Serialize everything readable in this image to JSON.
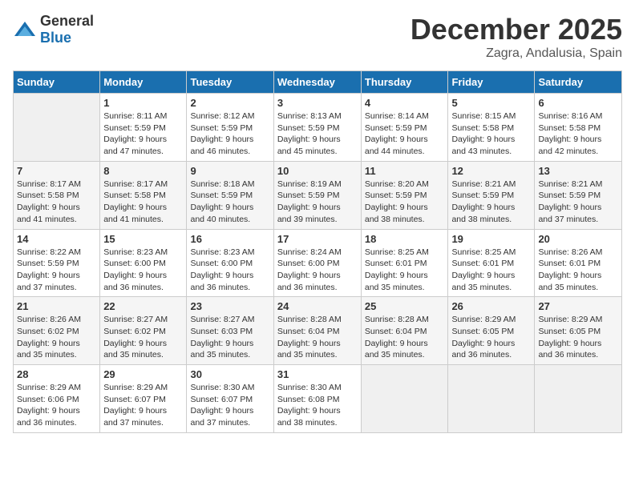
{
  "header": {
    "logo_general": "General",
    "logo_blue": "Blue",
    "month": "December 2025",
    "location": "Zagra, Andalusia, Spain"
  },
  "calendar": {
    "days_of_week": [
      "Sunday",
      "Monday",
      "Tuesday",
      "Wednesday",
      "Thursday",
      "Friday",
      "Saturday"
    ],
    "weeks": [
      [
        {
          "day": "",
          "info": ""
        },
        {
          "day": "1",
          "info": "Sunrise: 8:11 AM\nSunset: 5:59 PM\nDaylight: 9 hours\nand 47 minutes."
        },
        {
          "day": "2",
          "info": "Sunrise: 8:12 AM\nSunset: 5:59 PM\nDaylight: 9 hours\nand 46 minutes."
        },
        {
          "day": "3",
          "info": "Sunrise: 8:13 AM\nSunset: 5:59 PM\nDaylight: 9 hours\nand 45 minutes."
        },
        {
          "day": "4",
          "info": "Sunrise: 8:14 AM\nSunset: 5:59 PM\nDaylight: 9 hours\nand 44 minutes."
        },
        {
          "day": "5",
          "info": "Sunrise: 8:15 AM\nSunset: 5:58 PM\nDaylight: 9 hours\nand 43 minutes."
        },
        {
          "day": "6",
          "info": "Sunrise: 8:16 AM\nSunset: 5:58 PM\nDaylight: 9 hours\nand 42 minutes."
        }
      ],
      [
        {
          "day": "7",
          "info": "Sunrise: 8:17 AM\nSunset: 5:58 PM\nDaylight: 9 hours\nand 41 minutes."
        },
        {
          "day": "8",
          "info": "Sunrise: 8:17 AM\nSunset: 5:58 PM\nDaylight: 9 hours\nand 41 minutes."
        },
        {
          "day": "9",
          "info": "Sunrise: 8:18 AM\nSunset: 5:59 PM\nDaylight: 9 hours\nand 40 minutes."
        },
        {
          "day": "10",
          "info": "Sunrise: 8:19 AM\nSunset: 5:59 PM\nDaylight: 9 hours\nand 39 minutes."
        },
        {
          "day": "11",
          "info": "Sunrise: 8:20 AM\nSunset: 5:59 PM\nDaylight: 9 hours\nand 38 minutes."
        },
        {
          "day": "12",
          "info": "Sunrise: 8:21 AM\nSunset: 5:59 PM\nDaylight: 9 hours\nand 38 minutes."
        },
        {
          "day": "13",
          "info": "Sunrise: 8:21 AM\nSunset: 5:59 PM\nDaylight: 9 hours\nand 37 minutes."
        }
      ],
      [
        {
          "day": "14",
          "info": "Sunrise: 8:22 AM\nSunset: 5:59 PM\nDaylight: 9 hours\nand 37 minutes."
        },
        {
          "day": "15",
          "info": "Sunrise: 8:23 AM\nSunset: 6:00 PM\nDaylight: 9 hours\nand 36 minutes."
        },
        {
          "day": "16",
          "info": "Sunrise: 8:23 AM\nSunset: 6:00 PM\nDaylight: 9 hours\nand 36 minutes."
        },
        {
          "day": "17",
          "info": "Sunrise: 8:24 AM\nSunset: 6:00 PM\nDaylight: 9 hours\nand 36 minutes."
        },
        {
          "day": "18",
          "info": "Sunrise: 8:25 AM\nSunset: 6:01 PM\nDaylight: 9 hours\nand 35 minutes."
        },
        {
          "day": "19",
          "info": "Sunrise: 8:25 AM\nSunset: 6:01 PM\nDaylight: 9 hours\nand 35 minutes."
        },
        {
          "day": "20",
          "info": "Sunrise: 8:26 AM\nSunset: 6:01 PM\nDaylight: 9 hours\nand 35 minutes."
        }
      ],
      [
        {
          "day": "21",
          "info": "Sunrise: 8:26 AM\nSunset: 6:02 PM\nDaylight: 9 hours\nand 35 minutes."
        },
        {
          "day": "22",
          "info": "Sunrise: 8:27 AM\nSunset: 6:02 PM\nDaylight: 9 hours\nand 35 minutes."
        },
        {
          "day": "23",
          "info": "Sunrise: 8:27 AM\nSunset: 6:03 PM\nDaylight: 9 hours\nand 35 minutes."
        },
        {
          "day": "24",
          "info": "Sunrise: 8:28 AM\nSunset: 6:04 PM\nDaylight: 9 hours\nand 35 minutes."
        },
        {
          "day": "25",
          "info": "Sunrise: 8:28 AM\nSunset: 6:04 PM\nDaylight: 9 hours\nand 35 minutes."
        },
        {
          "day": "26",
          "info": "Sunrise: 8:29 AM\nSunset: 6:05 PM\nDaylight: 9 hours\nand 36 minutes."
        },
        {
          "day": "27",
          "info": "Sunrise: 8:29 AM\nSunset: 6:05 PM\nDaylight: 9 hours\nand 36 minutes."
        }
      ],
      [
        {
          "day": "28",
          "info": "Sunrise: 8:29 AM\nSunset: 6:06 PM\nDaylight: 9 hours\nand 36 minutes."
        },
        {
          "day": "29",
          "info": "Sunrise: 8:29 AM\nSunset: 6:07 PM\nDaylight: 9 hours\nand 37 minutes."
        },
        {
          "day": "30",
          "info": "Sunrise: 8:30 AM\nSunset: 6:07 PM\nDaylight: 9 hours\nand 37 minutes."
        },
        {
          "day": "31",
          "info": "Sunrise: 8:30 AM\nSunset: 6:08 PM\nDaylight: 9 hours\nand 38 minutes."
        },
        {
          "day": "",
          "info": ""
        },
        {
          "day": "",
          "info": ""
        },
        {
          "day": "",
          "info": ""
        }
      ]
    ]
  }
}
